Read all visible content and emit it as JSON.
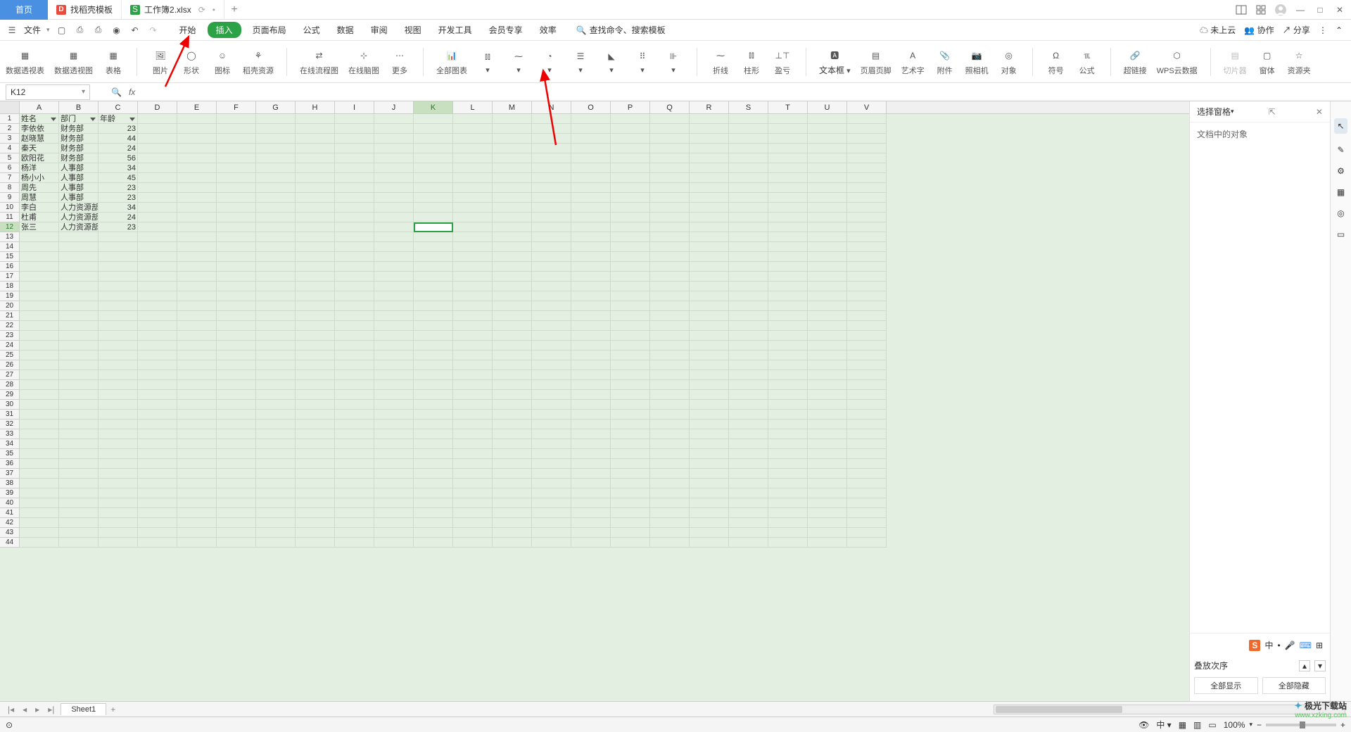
{
  "tabs": {
    "home": "首页",
    "template": "找稻壳模板",
    "file": "工作簿2.xlsx"
  },
  "menu": {
    "file": "文件",
    "start": "开始",
    "insert": "插入",
    "layout": "页面布局",
    "formula": "公式",
    "data": "数据",
    "review": "审阅",
    "view": "视图",
    "dev": "开发工具",
    "vip": "会员专享",
    "efficiency": "效率",
    "search_hint": "查找命令、搜索模板",
    "sync": "未上云",
    "collab": "协作",
    "share": "分享"
  },
  "ribbon": {
    "pivot_table": "数据透视表",
    "pivot_chart": "数据透视图",
    "table": "表格",
    "picture": "图片",
    "shape": "形状",
    "icon": "图标",
    "docer": "稻壳资源",
    "online_flow": "在线流程图",
    "online_mind": "在线脑图",
    "more": "更多",
    "all_charts": "全部图表",
    "line": "折线",
    "bar": "柱形",
    "updown": "盈亏",
    "textbox": "文本框",
    "header_footer": "页眉页脚",
    "wordart": "艺术字",
    "attach": "附件",
    "camera": "照相机",
    "object": "对象",
    "symbol": "符号",
    "equation": "公式",
    "hyperlink": "超链接",
    "cloud": "WPS云数据",
    "slicer": "切片器",
    "form": "窗体",
    "resource": "资源夹"
  },
  "namebox": "K12",
  "columns": [
    "A",
    "B",
    "C",
    "D",
    "E",
    "F",
    "G",
    "H",
    "I",
    "J",
    "K",
    "L",
    "M",
    "N",
    "O",
    "P",
    "Q",
    "R",
    "S",
    "T",
    "U",
    "V"
  ],
  "headers": {
    "name": "姓名",
    "dept": "部门",
    "age": "年龄"
  },
  "data_rows": [
    {
      "name": "李依依",
      "dept": "财务部",
      "age": "23"
    },
    {
      "name": "赵晓慧",
      "dept": "财务部",
      "age": "44"
    },
    {
      "name": "秦天",
      "dept": "财务部",
      "age": "24"
    },
    {
      "name": "欧阳花",
      "dept": "财务部",
      "age": "56"
    },
    {
      "name": "杨洋",
      "dept": "人事部",
      "age": "34"
    },
    {
      "name": "杨小小",
      "dept": "人事部",
      "age": "45"
    },
    {
      "name": "周先",
      "dept": "人事部",
      "age": "23"
    },
    {
      "name": "周慧",
      "dept": "人事部",
      "age": "23"
    },
    {
      "name": "李白",
      "dept": "人力资源部",
      "age": "34"
    },
    {
      "name": "杜甫",
      "dept": "人力资源部",
      "age": "24"
    },
    {
      "name": "张三",
      "dept": "人力资源部",
      "age": "23"
    }
  ],
  "total_rows": 44,
  "selected_col": "K",
  "selected_row": 12,
  "sidepanel": {
    "title": "选择窗格",
    "body": "文档中的对象",
    "order": "叠放次序",
    "show_all": "全部显示",
    "hide_all": "全部隐藏"
  },
  "sheet": {
    "name": "Sheet1"
  },
  "status": {
    "zoom": "100%"
  },
  "ime": {
    "zh": "中"
  },
  "watermark": {
    "l1": "极光下载站",
    "l2": "www.xzking.com"
  }
}
